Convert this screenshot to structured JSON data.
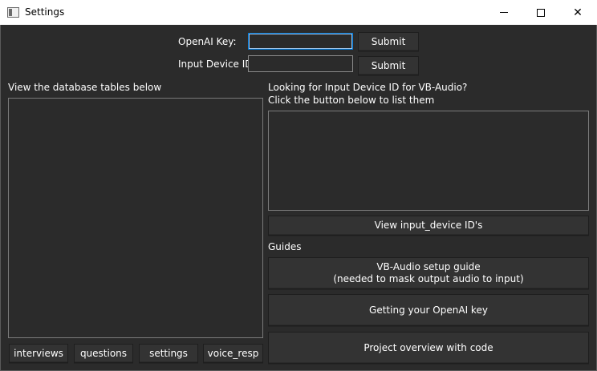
{
  "window": {
    "title": "Settings",
    "minimize_glyph": "minimize-icon",
    "maximize_glyph": "maximize-icon",
    "close_glyph": "✕"
  },
  "openai_key": {
    "label": "OpenAI Key:",
    "value": "",
    "submit_label": "Submit"
  },
  "input_device": {
    "label": "Input Device ID",
    "value": "",
    "submit_label": "Submit"
  },
  "database": {
    "heading": "View the database tables below",
    "tabs": [
      "interviews",
      "questions",
      "settings",
      "voice_resp"
    ]
  },
  "device_lookup": {
    "heading_line1": "Looking for Input Device ID for VB-Audio?",
    "heading_line2": "Click the button below to list them",
    "view_button_label": "View input_device ID's"
  },
  "guides": {
    "heading": "Guides",
    "vb_audio_line1": "VB-Audio setup guide",
    "vb_audio_line2": "(needed to mask output audio to input)",
    "openai_key_label": "Getting your OpenAI key",
    "project_overview_label": "Project overview with code"
  },
  "colors": {
    "background": "#2b2b2b",
    "button": "#333333",
    "focus_border": "#0078d7",
    "text": "#ffffff"
  }
}
